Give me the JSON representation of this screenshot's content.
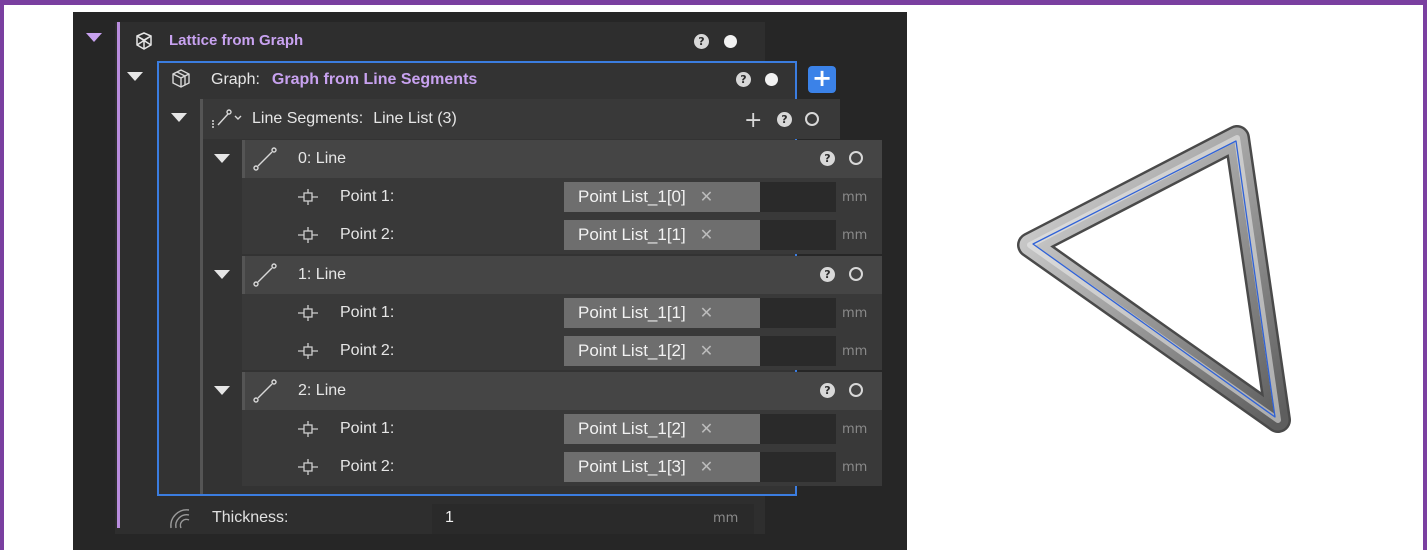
{
  "lattice": {
    "title": "Lattice from Graph",
    "help": "?"
  },
  "graph": {
    "label": "Graph:",
    "value": "Graph from Line Segments",
    "help": "?",
    "add": "+"
  },
  "segments": {
    "label": "Line Segments:",
    "value": "Line List (3)",
    "add": "+",
    "help": "?"
  },
  "lines": [
    {
      "header": "0:  Line",
      "help": "?",
      "points": [
        {
          "label": "Point 1:",
          "value": "Point List_1[0]",
          "unit": "mm"
        },
        {
          "label": "Point 2:",
          "value": "Point List_1[1]",
          "unit": "mm"
        }
      ]
    },
    {
      "header": "1:  Line",
      "help": "?",
      "points": [
        {
          "label": "Point 1:",
          "value": "Point List_1[1]",
          "unit": "mm"
        },
        {
          "label": "Point 2:",
          "value": "Point List_1[2]",
          "unit": "mm"
        }
      ]
    },
    {
      "header": "2:  Line",
      "help": "?",
      "points": [
        {
          "label": "Point 1:",
          "value": "Point List_1[2]",
          "unit": "mm"
        },
        {
          "label": "Point 2:",
          "value": "Point List_1[3]",
          "unit": "mm"
        }
      ]
    }
  ],
  "thickness": {
    "label": "Thickness:",
    "value": "1",
    "unit": "mm"
  },
  "colors": {
    "accent": "#3b82e8",
    "lattice_purple": "#c8a2f0",
    "frame": "#7a3fa0"
  }
}
